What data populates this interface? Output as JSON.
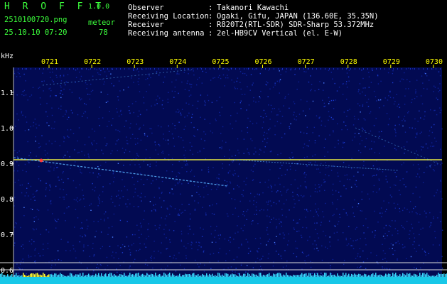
{
  "app": {
    "name": "H R O F F T",
    "version": "1.0.0"
  },
  "file": {
    "name": "2510100720.png",
    "datetime": "25.10.10 07:20"
  },
  "counter": {
    "label": "meteor",
    "value": "78"
  },
  "info": [
    {
      "key": "Observer",
      "value": "Takanori Kawachi"
    },
    {
      "key": "Receiving Location",
      "value": "Ogaki, Gifu, JAPAN (136.60E, 35.35N)"
    },
    {
      "key": "Receiver",
      "value": "R820T2(RTL-SDR) SDR-Sharp 53.372MHz"
    },
    {
      "key": "Receiving antenna",
      "value": "2el-HB9CV Vertical (el. E-W)"
    }
  ],
  "axis": {
    "unit": "kHz",
    "y_ticks": [
      "1.1",
      "1.0",
      "0.9",
      "0.8",
      "0.7",
      "0.6"
    ],
    "time_ticks": [
      "0721",
      "0722",
      "0723",
      "0724",
      "0725",
      "0726",
      "0727",
      "0728",
      "0729",
      "0730"
    ]
  },
  "colors": {
    "background": "#000000",
    "noise": "#0a1a8c",
    "carrier": "#ffff40",
    "meteor": "#5ab4ff",
    "text_green": "#3cff3c",
    "tick_yellow": "#ffff00"
  }
}
